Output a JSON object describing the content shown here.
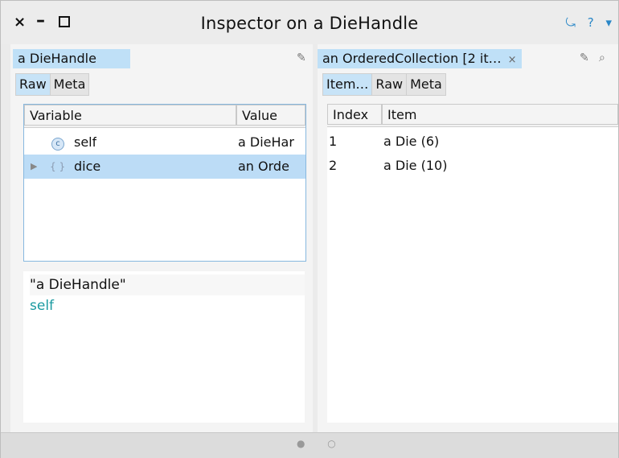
{
  "window": {
    "title": "Inspector on a DieHandle",
    "close_glyph": "×",
    "minimize_glyph": "–",
    "right_icons": [
      "⤿",
      "?",
      "▾"
    ]
  },
  "left_pane": {
    "title": "a DieHandle",
    "tabs": [
      "Raw",
      "Meta"
    ],
    "active_tab": "Raw",
    "columns": [
      "Variable",
      "Value"
    ],
    "rows": [
      {
        "name": "self",
        "value": "a DieHar",
        "icon": "class-badge-icon"
      },
      {
        "name": "dice",
        "value": "an Orde",
        "icon": "braces-icon"
      }
    ],
    "code_line1": "\"a DieHandle\"",
    "code_line2": "self"
  },
  "right_pane": {
    "title": "an OrderedCollection [2 it…",
    "close_glyph": "×",
    "tabs": [
      "Item…",
      "Raw",
      "Meta"
    ],
    "active_tab": "Item…",
    "columns": [
      "Index",
      "Item"
    ],
    "rows": [
      {
        "index": "1",
        "item": "a Die (6)"
      },
      {
        "index": "2",
        "item": "a Die (10)"
      }
    ]
  },
  "footer": {
    "dots": "● ○"
  },
  "colors": {
    "accent": "#bfe0f7",
    "selected_row": "#bcdcf6",
    "code_token": "#1a9aa0"
  }
}
